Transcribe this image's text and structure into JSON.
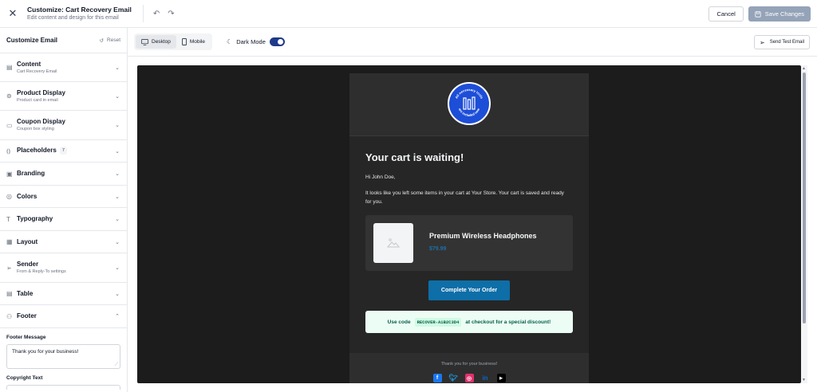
{
  "window": {
    "title": "Customize: Cart Recovery Email",
    "subtitle": "Edit content and design for this email"
  },
  "actions": {
    "cancel_label": "Cancel",
    "save_label": "Save Changes"
  },
  "sidebar": {
    "title": "Customize Email",
    "reset_label": "Reset",
    "sections": [
      {
        "label": "Content",
        "sub": "Cart Recovery Email",
        "icon": "document-icon"
      },
      {
        "label": "Product Display",
        "sub": "Product card in email",
        "icon": "package-icon"
      },
      {
        "label": "Coupon Display",
        "sub": "Coupon box styling",
        "icon": "ticket-icon"
      },
      {
        "label": "Placeholders",
        "badge": "7",
        "icon": "braces-icon"
      },
      {
        "label": "Branding",
        "icon": "image-icon"
      },
      {
        "label": "Colors",
        "icon": "palette-icon"
      },
      {
        "label": "Typography",
        "icon": "type-icon"
      },
      {
        "label": "Layout",
        "icon": "layout-icon"
      },
      {
        "label": "Sender",
        "sub": "From & Reply-To settings",
        "icon": "send-icon"
      },
      {
        "label": "Table",
        "icon": "table-icon"
      },
      {
        "label": "Footer",
        "icon": "footer-icon",
        "expanded": true
      }
    ],
    "footer_message_label": "Footer Message",
    "footer_message_value": "Thank you for your business!",
    "copyright_label": "Copyright Text"
  },
  "toolbar": {
    "desktop_label": "Desktop",
    "mobile_label": "Mobile",
    "dark_mode_label": "Dark Mode",
    "dark_mode_on": true,
    "send_test_label": "Send Test Email"
  },
  "email": {
    "heading": "Your cart is waiting!",
    "greeting": "Hi John Doe,",
    "body": "It looks like you left some items in your cart at Your Store. Your cart is saved and ready for you.",
    "product_name": "Premium Wireless Headphones",
    "product_price": "$79.99",
    "cta_label": "Complete Your Order",
    "coupon_prefix": "Use code",
    "coupon_code": "RECOVER-A1B2C3D4",
    "coupon_suffix": "at checkout for a special discount!",
    "footer_text": "Thank you for your business!",
    "logo_text_top": "All necessary tools",
    "logo_text_bottom": "are included now"
  },
  "colors": {
    "accent": "#0e6ea8",
    "logo_bg": "#1d4ed8",
    "canvas_bg": "#1c1c1c",
    "save_button": "#94a3b8"
  }
}
